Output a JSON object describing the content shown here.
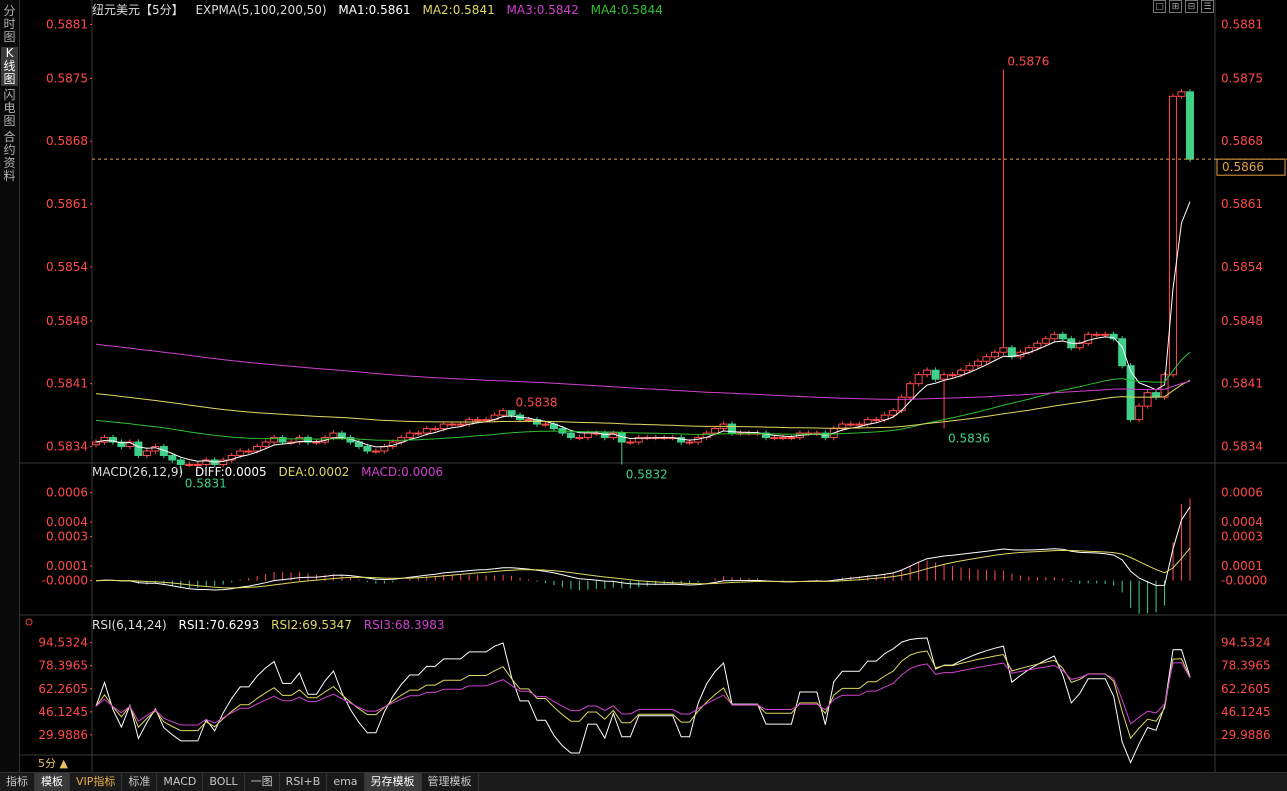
{
  "side_tabs": [
    "分时图",
    "K线图",
    "闪电图",
    "合约资料"
  ],
  "active_side_tab": 1,
  "header": {
    "symbol": "纽元美元【5分】",
    "symbol_icon": "minus-circle-icon",
    "indicator": "EXPMA(5,100,200,50)",
    "ma1": "MA1:0.5861",
    "ma2": "MA2:0.5841",
    "ma3": "MA3:0.5842",
    "ma4": "MA4:0.5844"
  },
  "macd_header": {
    "title": "MACD(26,12,9)",
    "diff": "DIFF:0.0005",
    "dea": "DEA:0.0002",
    "macd": "MACD:0.0006"
  },
  "rsi_header": {
    "title": "RSI(6,14,24)",
    "rsi1": "RSI1:70.6293",
    "rsi2": "RSI2:69.5347",
    "rsi3": "RSI3:68.3983"
  },
  "window_buttons": [
    "□",
    "⊞",
    "⊟",
    "☰"
  ],
  "bottom_tabs": [
    "指标",
    "模板",
    "VIP指标",
    "标准",
    "MACD",
    "BOLL",
    "一图",
    "RSI+B",
    "ema",
    "另存模板",
    "管理模板"
  ],
  "period_label": "5分",
  "colors": {
    "up": "#ff4a4a",
    "down": "#3fd08a",
    "ma1": "#ffffff",
    "ma2": "#e0d860",
    "ma3": "#d040d0",
    "ma4": "#30c030",
    "axis": "#ff4a4a",
    "current": "#e8a040"
  },
  "chart_data": [
    {
      "type": "candlestick",
      "yticks": [
        "0.5881",
        "0.5875",
        "0.5868",
        "0.5861",
        "0.5854",
        "0.5848",
        "0.5841",
        "0.5834"
      ],
      "ylim": [
        0.58325,
        0.58815
      ],
      "current_price": "0.5866",
      "annotations": [
        {
          "label": "0.5876",
          "index": 107,
          "kind": "high"
        },
        {
          "label": "0.5838",
          "index": 49,
          "kind": "high"
        },
        {
          "label": "0.5831",
          "index": 10,
          "kind": "low"
        },
        {
          "label": "0.5832",
          "index": 62,
          "kind": "low"
        },
        {
          "label": "0.5836",
          "index": 100,
          "kind": "low"
        }
      ],
      "closes": [
        0.58345,
        0.5835,
        0.58345,
        0.5834,
        0.58345,
        0.5833,
        0.58335,
        0.5834,
        0.5833,
        0.58325,
        0.5832,
        0.5832,
        0.5832,
        0.58325,
        0.5832,
        0.58325,
        0.5833,
        0.58335,
        0.58335,
        0.5834,
        0.58345,
        0.5835,
        0.58345,
        0.58345,
        0.5835,
        0.58345,
        0.58345,
        0.5835,
        0.58355,
        0.5835,
        0.58345,
        0.5834,
        0.58335,
        0.58335,
        0.5834,
        0.58345,
        0.5835,
        0.58355,
        0.58355,
        0.5836,
        0.5836,
        0.58365,
        0.58365,
        0.58365,
        0.5837,
        0.5837,
        0.5837,
        0.58375,
        0.5838,
        0.58375,
        0.5837,
        0.5837,
        0.58365,
        0.58365,
        0.5836,
        0.58355,
        0.5835,
        0.5835,
        0.58355,
        0.58355,
        0.5835,
        0.58355,
        0.58345,
        0.58345,
        0.5835,
        0.5835,
        0.5835,
        0.5835,
        0.5835,
        0.58345,
        0.58345,
        0.5835,
        0.58355,
        0.5836,
        0.58365,
        0.58355,
        0.58355,
        0.58355,
        0.58355,
        0.5835,
        0.5835,
        0.5835,
        0.5835,
        0.58355,
        0.58355,
        0.58355,
        0.5835,
        0.5836,
        0.58365,
        0.58365,
        0.58365,
        0.5837,
        0.5837,
        0.58375,
        0.5838,
        0.58395,
        0.5841,
        0.5842,
        0.58425,
        0.58415,
        0.5842,
        0.5842,
        0.58425,
        0.5843,
        0.58435,
        0.5844,
        0.58445,
        0.5845,
        0.5844,
        0.58445,
        0.5845,
        0.58455,
        0.5846,
        0.58465,
        0.5846,
        0.5845,
        0.58455,
        0.58465,
        0.58465,
        0.58465,
        0.5846,
        0.5843,
        0.5837,
        0.58385,
        0.584,
        0.58395,
        0.5842,
        0.5873,
        0.58735,
        0.5866
      ],
      "ma_lines": {
        "ma1": "fast",
        "ma2": "mid",
        "ma3": "slow",
        "ma4": "medium"
      }
    },
    {
      "type": "bar",
      "name": "MACD",
      "yticks": [
        "0.0006",
        "0.0004",
        "0.0003",
        "0.0001",
        "-0.0000"
      ],
      "ylim": [
        -0.0002,
        0.0007
      ]
    },
    {
      "type": "line",
      "name": "RSI",
      "yticks": [
        "94.5324",
        "78.3965",
        "62.2605",
        "46.1245",
        "29.9886"
      ],
      "ylim": [
        18,
        102
      ]
    }
  ]
}
